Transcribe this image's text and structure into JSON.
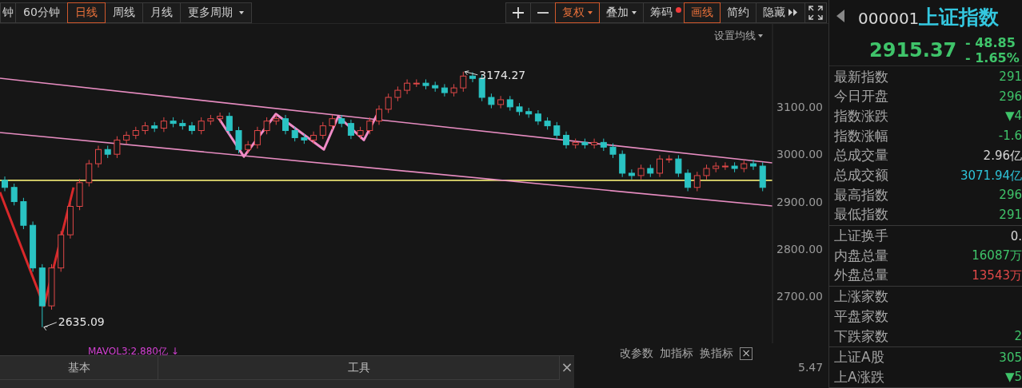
{
  "toolbar": {
    "period_tabs": [
      {
        "label": "钟",
        "selected": false
      },
      {
        "label": "60分钟",
        "selected": false
      },
      {
        "label": "日线",
        "selected": true
      },
      {
        "label": "周线",
        "selected": false
      },
      {
        "label": "月线",
        "selected": false
      },
      {
        "label": "更多周期",
        "selected": false,
        "dropdown": true
      }
    ],
    "tools": [
      {
        "kind": "plus",
        "selected": false
      },
      {
        "kind": "minus",
        "selected": false
      },
      {
        "kind": "text",
        "label": "复权",
        "dropdown": true,
        "selected": true
      },
      {
        "kind": "text",
        "label": "叠加",
        "dropdown": true,
        "selected": false
      },
      {
        "kind": "text",
        "label": "筹码",
        "dot": true,
        "selected": false
      },
      {
        "kind": "text",
        "label": "画线",
        "selected": true
      },
      {
        "kind": "text",
        "label": "简约",
        "selected": false
      },
      {
        "kind": "text",
        "label": "隐藏",
        "more": true,
        "selected": false
      },
      {
        "kind": "fullscreen",
        "selected": false
      }
    ]
  },
  "chart": {
    "ma_settings": "设置均线",
    "chart_data": {
      "type": "candlestick",
      "ylim": [
        2601,
        3275
      ],
      "yticks": [
        {
          "value": 3100,
          "label": "3100.00"
        },
        {
          "value": 3000,
          "label": "3000.00"
        },
        {
          "value": 2900,
          "label": "2900.00"
        },
        {
          "value": 2800,
          "label": "2800.00"
        },
        {
          "value": 2700,
          "label": "2700.00"
        }
      ],
      "ohlc": [
        [
          2945,
          2953,
          2922,
          2930
        ],
        [
          2930,
          2938,
          2892,
          2900
        ],
        [
          2900,
          2908,
          2842,
          2850
        ],
        [
          2850,
          2858,
          2752,
          2760
        ],
        [
          2760,
          2768,
          2635.09,
          2680
        ],
        [
          2680,
          2768,
          2672,
          2760
        ],
        [
          2760,
          2838,
          2752,
          2830
        ],
        [
          2830,
          2898,
          2822,
          2890
        ],
        [
          2890,
          2948,
          2882,
          2940
        ],
        [
          2940,
          2988,
          2932,
          2980
        ],
        [
          2980,
          3018,
          2972,
          3010
        ],
        [
          3010,
          3018,
          2992,
          3000
        ],
        [
          3000,
          3038,
          2992,
          3030
        ],
        [
          3030,
          3048,
          3022,
          3040
        ],
        [
          3040,
          3058,
          3032,
          3050
        ],
        [
          3050,
          3068,
          3042,
          3060
        ],
        [
          3060,
          3068,
          3047,
          3055
        ],
        [
          3055,
          3078,
          3047,
          3070
        ],
        [
          3070,
          3078,
          3057,
          3065
        ],
        [
          3065,
          3073,
          3052,
          3060
        ],
        [
          3060,
          3068,
          3042,
          3050
        ],
        [
          3050,
          3078,
          3042,
          3070
        ],
        [
          3070,
          3083,
          3062,
          3075
        ],
        [
          3075,
          3088,
          3067,
          3080
        ],
        [
          3080,
          3088,
          3042,
          3050
        ],
        [
          3050,
          3058,
          3002,
          3010
        ],
        [
          3010,
          3028,
          3002,
          3020
        ],
        [
          3020,
          3058,
          3012,
          3050
        ],
        [
          3050,
          3078,
          3042,
          3070
        ],
        [
          3070,
          3083,
          3062,
          3075
        ],
        [
          3075,
          3083,
          3042,
          3050
        ],
        [
          3050,
          3058,
          3027,
          3035
        ],
        [
          3035,
          3043,
          3022,
          3030
        ],
        [
          3030,
          3048,
          3022,
          3040
        ],
        [
          3040,
          3068,
          3032,
          3060
        ],
        [
          3060,
          3083,
          3052,
          3075
        ],
        [
          3075,
          3083,
          3057,
          3065
        ],
        [
          3065,
          3073,
          3032,
          3040
        ],
        [
          3040,
          3058,
          3032,
          3050
        ],
        [
          3050,
          3078,
          3042,
          3070
        ],
        [
          3070,
          3103,
          3062,
          3095
        ],
        [
          3095,
          3128,
          3087,
          3120
        ],
        [
          3120,
          3143,
          3112,
          3135
        ],
        [
          3135,
          3158,
          3127,
          3150
        ],
        [
          3150,
          3158,
          3142,
          3150
        ],
        [
          3150,
          3158,
          3137,
          3145
        ],
        [
          3145,
          3153,
          3132,
          3140
        ],
        [
          3140,
          3148,
          3122,
          3130
        ],
        [
          3130,
          3148,
          3122,
          3140
        ],
        [
          3140,
          3174.27,
          3132,
          3165
        ],
        [
          3165,
          3173,
          3152,
          3160
        ],
        [
          3160,
          3168,
          3112,
          3120
        ],
        [
          3120,
          3128,
          3097,
          3105
        ],
        [
          3105,
          3123,
          3097,
          3115
        ],
        [
          3115,
          3123,
          3092,
          3100
        ],
        [
          3100,
          3108,
          3082,
          3090
        ],
        [
          3090,
          3098,
          3077,
          3085
        ],
        [
          3085,
          3093,
          3062,
          3070
        ],
        [
          3070,
          3078,
          3052,
          3060
        ],
        [
          3060,
          3068,
          3032,
          3040
        ],
        [
          3040,
          3048,
          3012,
          3020
        ],
        [
          3020,
          3033,
          3012,
          3025
        ],
        [
          3025,
          3033,
          3012,
          3020
        ],
        [
          3020,
          3033,
          3012,
          3025
        ],
        [
          3025,
          3033,
          3007,
          3015
        ],
        [
          3015,
          3023,
          2992,
          3000
        ],
        [
          3000,
          3008,
          2952,
          2960
        ],
        [
          2960,
          2968,
          2947,
          2955
        ],
        [
          2955,
          2978,
          2947,
          2970
        ],
        [
          2970,
          2978,
          2952,
          2960
        ],
        [
          2960,
          2998,
          2952,
          2990
        ],
        [
          2990,
          2998,
          2982,
          2990
        ],
        [
          2990,
          2998,
          2952,
          2960
        ],
        [
          2960,
          2968,
          2922,
          2930
        ],
        [
          2930,
          2963,
          2922,
          2955
        ],
        [
          2955,
          2978,
          2947,
          2970
        ],
        [
          2970,
          2983,
          2962,
          2975
        ],
        [
          2975,
          2983,
          2967,
          2975
        ],
        [
          2975,
          2983,
          2962,
          2970
        ],
        [
          2970,
          2988,
          2962,
          2980
        ],
        [
          2980,
          2988,
          2967,
          2975
        ],
        [
          2975,
          2983,
          2922,
          2930
        ]
      ],
      "annotations": [
        "3174.27",
        "2635.09"
      ]
    }
  },
  "indicator": {
    "label": "MAVOL3:2.880亿 ↓",
    "actions": [
      "改参数",
      "加指标",
      "换指标"
    ],
    "close": "×",
    "axis_value": "5.47"
  },
  "bottom_panel": {
    "tabs": [
      "基本",
      "工具"
    ],
    "close": "×"
  },
  "quote": {
    "code": "000001",
    "name": "上证指数",
    "price": "2915.37",
    "change": "- 48.85",
    "change_pct": "- 1.65%",
    "groups": [
      [
        {
          "label": "最新指数",
          "value": "291",
          "color": "#3fc46a"
        },
        {
          "label": "今日开盘",
          "value": "296",
          "color": "#3fc46a"
        },
        {
          "label": "指数涨跌",
          "value": "▼4",
          "color": "#3fc46a"
        },
        {
          "label": "指数涨幅",
          "value": "-1.6",
          "color": "#3fc46a"
        },
        {
          "label": "总成交量",
          "value": "2.96亿",
          "color": "#d8d8d8"
        },
        {
          "label": "总成交额",
          "value": "3071.94亿",
          "color": "#2ec3d8"
        },
        {
          "label": "最高指数",
          "value": "296",
          "color": "#3fc46a"
        },
        {
          "label": "最低指数",
          "value": "291",
          "color": "#3fc46a"
        }
      ],
      [
        {
          "label": "上证换手",
          "value": "0.",
          "color": "#d8d8d8"
        },
        {
          "label": "内盘总量",
          "value": "16087万",
          "color": "#3fc46a"
        },
        {
          "label": "外盘总量",
          "value": "13543万",
          "color": "#e04848"
        }
      ],
      [
        {
          "label": "上涨家数"
        },
        {
          "label": "平盘家数"
        },
        {
          "label": "下跌家数",
          "value": "2",
          "color": "#3fc46a"
        }
      ],
      [
        {
          "label": "上证A股",
          "value": "305",
          "color": "#3fc46a"
        },
        {
          "label": "上A涨跌",
          "value": "▼5",
          "color": "#3fc46a"
        }
      ]
    ]
  }
}
